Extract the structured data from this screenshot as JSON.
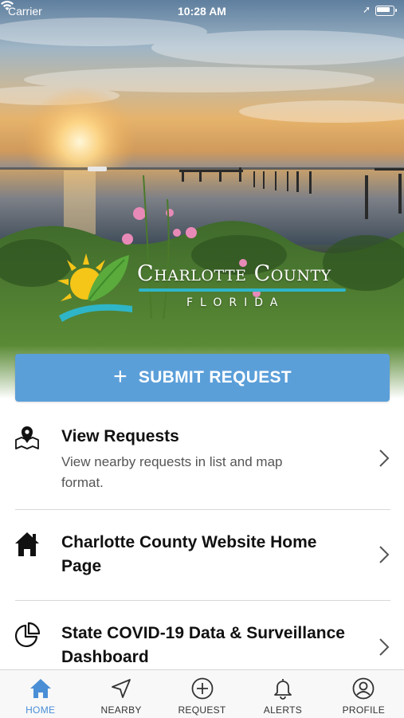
{
  "status_bar": {
    "carrier": "Carrier",
    "time": "10:28 AM",
    "icons": [
      "wifi-icon",
      "location-arrow-icon",
      "battery-icon"
    ]
  },
  "hero": {
    "logo": {
      "name": "Charlotte County",
      "state": "FLORIDA"
    }
  },
  "submit_button": {
    "icon": "plus-icon",
    "label": "SUBMIT REQUEST",
    "color": "#5b9fd9"
  },
  "menu": {
    "items": [
      {
        "icon": "map-pin-icon",
        "title": "View Requests",
        "subtitle": "View nearby requests in list and map format."
      },
      {
        "icon": "home-icon",
        "title": "Charlotte County Website Home Page",
        "subtitle": ""
      },
      {
        "icon": "pie-chart-icon",
        "title": "State COVID-19 Data & Surveillance Dashboard",
        "subtitle": ""
      }
    ]
  },
  "tab_bar": {
    "active_color": "#4a8fd6",
    "tabs": [
      {
        "label": "HOME",
        "icon": "home-icon",
        "active": true
      },
      {
        "label": "NEARBY",
        "icon": "navigation-arrow-icon",
        "active": false
      },
      {
        "label": "REQUEST",
        "icon": "plus-circle-icon",
        "active": false
      },
      {
        "label": "ALERTS",
        "icon": "bell-icon",
        "active": false
      },
      {
        "label": "PROFILE",
        "icon": "user-circle-icon",
        "active": false
      }
    ]
  }
}
